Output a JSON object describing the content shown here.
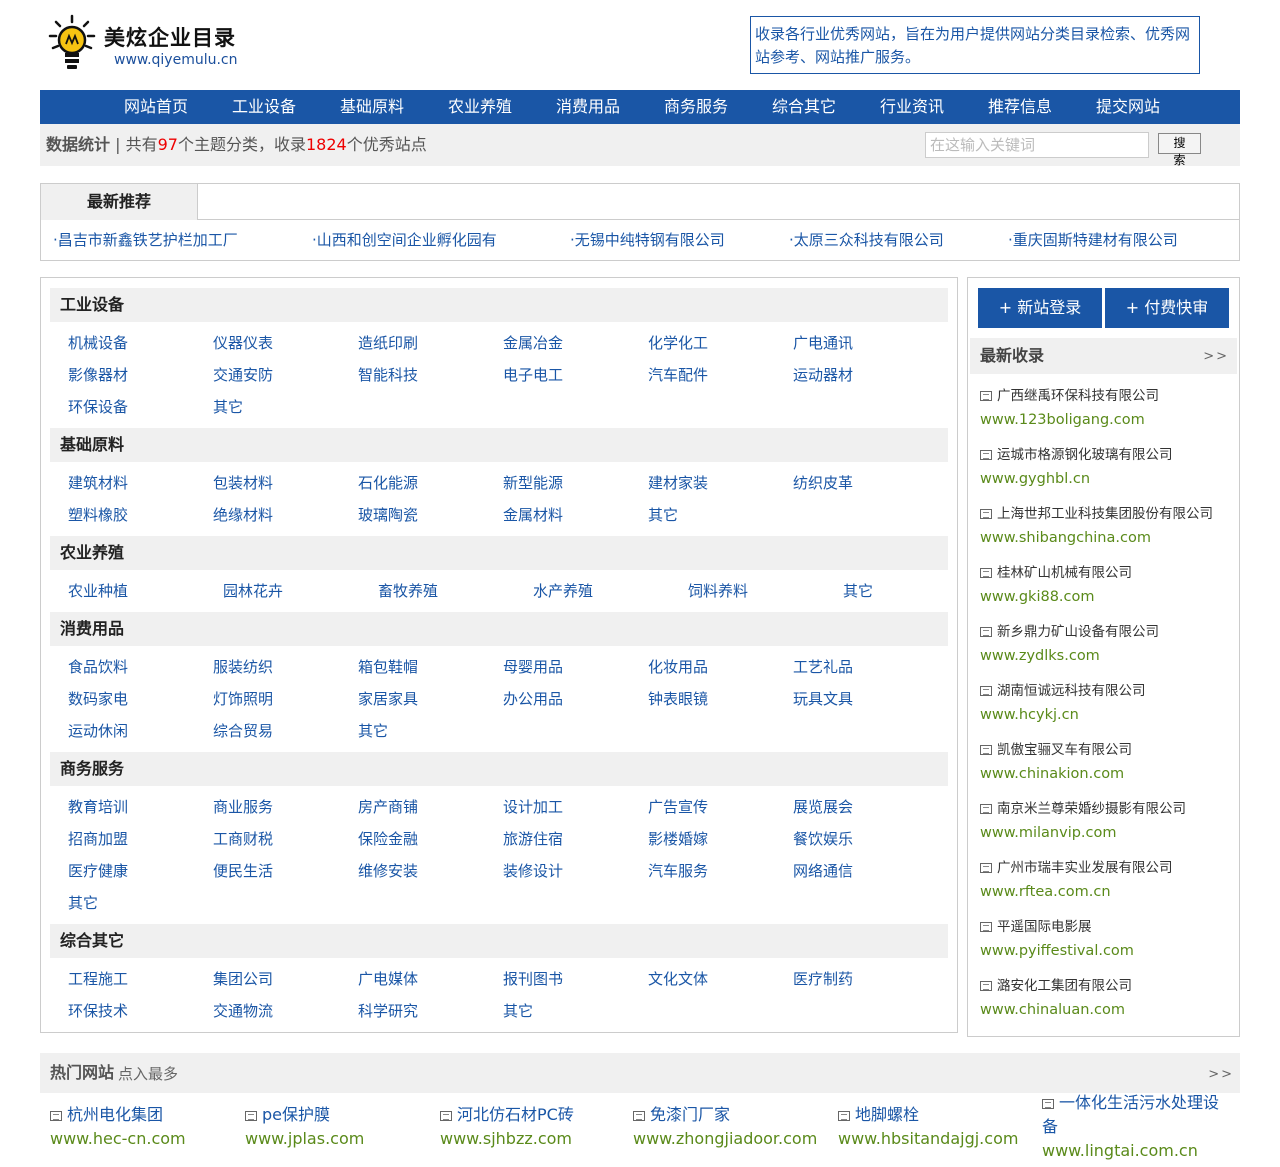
{
  "header": {
    "logo_name": "美炫企业目录",
    "logo_url": "www.qiyemulu.cn",
    "intro": "收录各行业优秀网站，旨在为用户提供网站分类目录检索、优秀网站参考、网站推广服务。"
  },
  "nav": [
    "网站首页",
    "工业设备",
    "基础原料",
    "农业养殖",
    "消费用品",
    "商务服务",
    "综合其它",
    "行业资讯",
    "推荐信息",
    "提交网站"
  ],
  "stats": {
    "label": "数据统计",
    "sep": " | 共有",
    "topics": "97",
    "mid": "个主题分类，收录",
    "sites": "1824",
    "tail": "个优秀站点"
  },
  "search": {
    "placeholder": "在这输入关键词",
    "button": "搜 索"
  },
  "recommend": {
    "title": "最新推荐",
    "links": [
      "·昌吉市新鑫铁艺护栏加工厂",
      "·山西和创空间企业孵化园有",
      "·无锡中纯特钢有限公司",
      "·太原三众科技有限公司",
      "·重庆固斯特建材有限公司"
    ]
  },
  "categories": [
    {
      "title": "工业设备",
      "cols": 6,
      "items": [
        "机械设备",
        "仪器仪表",
        "造纸印刷",
        "金属冶金",
        "化学化工",
        "广电通讯",
        "影像器材",
        "交通安防",
        "智能科技",
        "电子电工",
        "汽车配件",
        "运动器材",
        "环保设备",
        "其它"
      ]
    },
    {
      "title": "基础原料",
      "cols": 6,
      "items": [
        "建筑材料",
        "包装材料",
        "石化能源",
        "新型能源",
        "建材家装",
        "纺织皮革",
        "塑料橡胶",
        "绝缘材料",
        "玻璃陶瓷",
        "金属材料",
        "其它"
      ]
    },
    {
      "title": "农业养殖",
      "cols": 6,
      "wide": true,
      "items": [
        "农业种植",
        "园林花卉",
        "畜牧养殖",
        "水产养殖",
        "饲料养料",
        "其它"
      ]
    },
    {
      "title": "消费用品",
      "cols": 6,
      "items": [
        "食品饮料",
        "服装纺织",
        "箱包鞋帽",
        "母婴用品",
        "化妆用品",
        "工艺礼品",
        "数码家电",
        "灯饰照明",
        "家居家具",
        "办公用品",
        "钟表眼镜",
        "玩具文具",
        "运动休闲",
        "综合贸易",
        "其它"
      ]
    },
    {
      "title": "商务服务",
      "cols": 6,
      "items": [
        "教育培训",
        "商业服务",
        "房产商铺",
        "设计加工",
        "广告宣传",
        "展览展会",
        "招商加盟",
        "工商财税",
        "保险金融",
        "旅游住宿",
        "影楼婚嫁",
        "餐饮娱乐",
        "医疗健康",
        "便民生活",
        "维修安装",
        "装修设计",
        "汽车服务",
        "网络通信",
        "其它"
      ]
    },
    {
      "title": "综合其它",
      "cols": 6,
      "items": [
        "工程施工",
        "集团公司",
        "广电媒体",
        "报刊图书",
        "文化文体",
        "医疗制药",
        "环保技术",
        "交通物流",
        "科学研究",
        "其它"
      ]
    }
  ],
  "sidebar": {
    "btn_new": "+ 新站登录",
    "btn_paid": "+ 付费快审",
    "title": "最新收录",
    "more": ">>",
    "items": [
      {
        "name": "广西继禹环保科技有限公司",
        "url": "www.123boligang.com"
      },
      {
        "name": "运城市格源钢化玻璃有限公司",
        "url": "www.gyghbl.cn"
      },
      {
        "name": "上海世邦工业科技集团股份有限公司",
        "url": "www.shibangchina.com"
      },
      {
        "name": "桂林矿山机械有限公司",
        "url": "www.gki88.com"
      },
      {
        "name": "新乡鼎力矿山设备有限公司",
        "url": "www.zydlks.com"
      },
      {
        "name": "湖南恒诚远科技有限公司",
        "url": "www.hcykj.cn"
      },
      {
        "name": "凯傲宝骊叉车有限公司",
        "url": "www.chinakion.com"
      },
      {
        "name": "南京米兰尊荣婚纱摄影有限公司",
        "url": "www.milanvip.com"
      },
      {
        "name": "广州市瑞丰实业发展有限公司",
        "url": "www.rftea.com.cn"
      },
      {
        "name": "平遥国际电影展",
        "url": "www.pyiffestival.com"
      },
      {
        "name": "潞安化工集团有限公司",
        "url": "www.chinaluan.com"
      }
    ]
  },
  "hot": {
    "title": "热门网站",
    "sub": "点入最多",
    "more": ">>",
    "items": [
      {
        "name": "杭州电化集团",
        "url": "www.hec-cn.com"
      },
      {
        "name": "pe保护膜",
        "url": "www.jplas.com"
      },
      {
        "name": "河北仿石材PC砖",
        "url": "www.sjhbzz.com"
      },
      {
        "name": "免漆门厂家",
        "url": "www.zhongjiadoor.com"
      },
      {
        "name": "地脚螺栓",
        "url": "www.hbsitandajgj.com"
      },
      {
        "name": "一体化生活污水处理设备",
        "url": "www.lingtai.com.cn"
      }
    ]
  }
}
